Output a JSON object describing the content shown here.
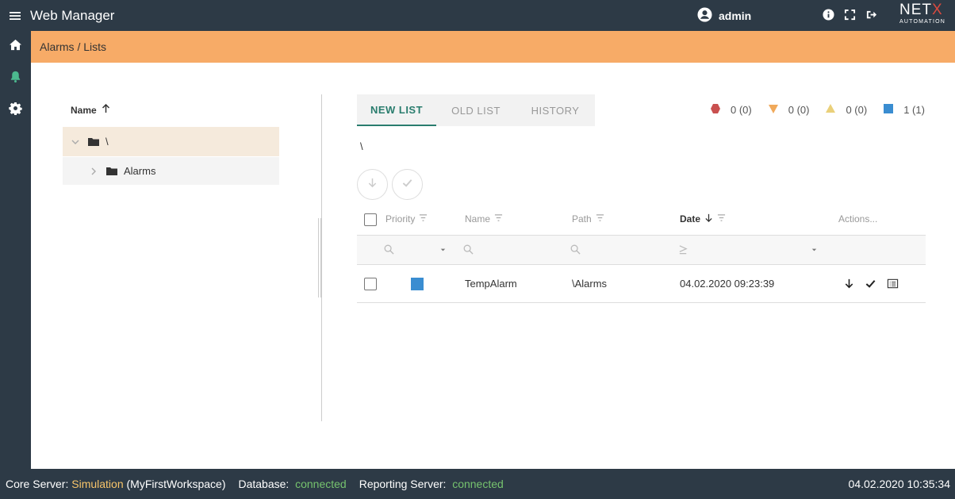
{
  "app": {
    "title": "Web Manager",
    "user": "admin"
  },
  "logo": {
    "brand_main": "NET",
    "brand_x": "X",
    "sub": "AUTOMATION"
  },
  "breadcrumb": "Alarms / Lists",
  "tree": {
    "header": "Name",
    "root_label": "\\",
    "child_label": "Alarms"
  },
  "tabs": [
    {
      "label": "NEW LIST",
      "active": true
    },
    {
      "label": "OLD LIST",
      "active": false
    },
    {
      "label": "HISTORY",
      "active": false
    }
  ],
  "counters": [
    {
      "icon": "hexagon-icon",
      "color": "#c9504f",
      "text": "0 (0)"
    },
    {
      "icon": "triangle-down-icon",
      "color": "#f0a95a",
      "text": "0 (0)"
    },
    {
      "icon": "triangle-up-icon",
      "color": "#ead07a",
      "text": "0 (0)"
    },
    {
      "icon": "square-icon",
      "color": "#3a8dd1",
      "text": "1 (1)"
    }
  ],
  "current_path": "\\",
  "table": {
    "columns": {
      "priority": "Priority",
      "name": "Name",
      "path": "Path",
      "date": "Date",
      "actions": "Actions..."
    },
    "rows": [
      {
        "priority_color": "#3a8dd1",
        "name": "TempAlarm",
        "path": "\\Alarms",
        "date": "04.02.2020 09:23:39"
      }
    ]
  },
  "status": {
    "core_label": "Core Server:",
    "core_value": "Simulation",
    "core_ws": "(MyFirstWorkspace)",
    "db_label": "Database:",
    "db_value": "connected",
    "rep_label": "Reporting Server:",
    "rep_value": "connected",
    "clock": "04.02.2020 10:35:34"
  }
}
